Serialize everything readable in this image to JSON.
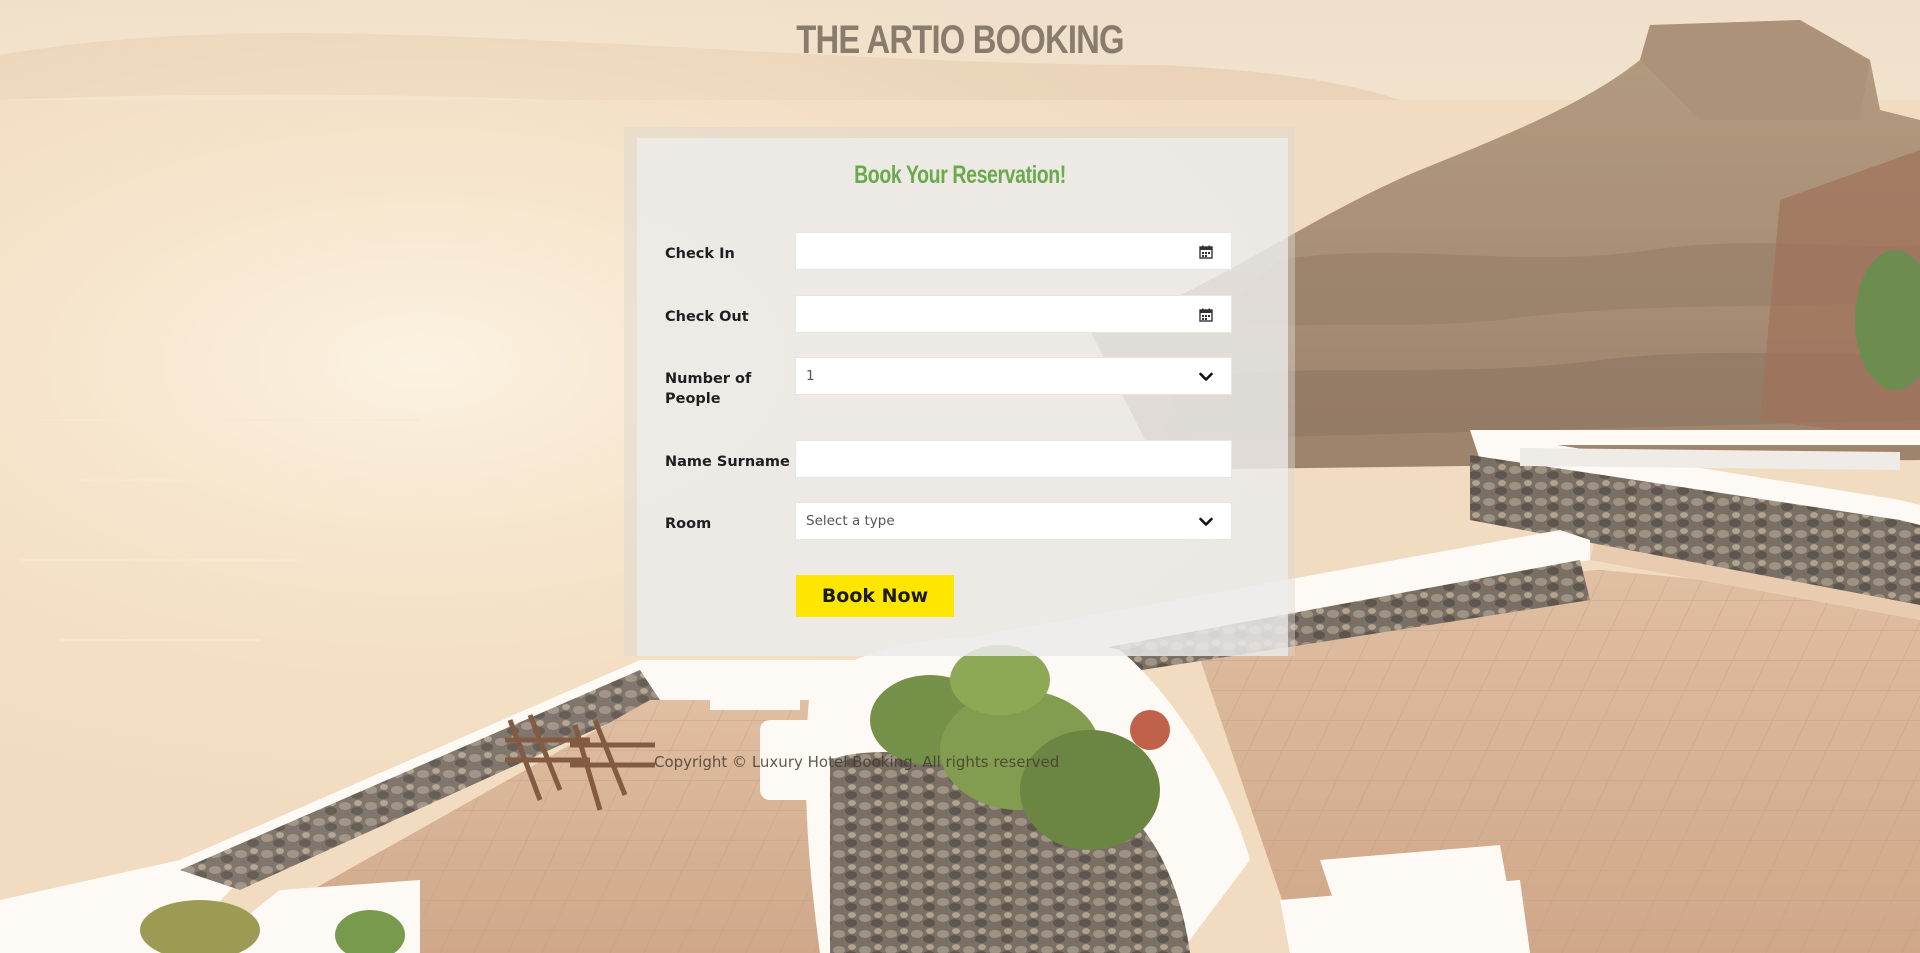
{
  "header": {
    "site_title": "THE ARTIO BOOKING"
  },
  "form": {
    "heading": "Book Your Reservation!",
    "check_in": {
      "label": "Check In",
      "value": "",
      "icon": "calendar-icon"
    },
    "check_out": {
      "label": "Check Out",
      "value": "",
      "icon": "calendar-icon"
    },
    "people": {
      "label": "Number of People",
      "selected": "1",
      "icon": "chevron-down-icon"
    },
    "name": {
      "label": "Name Surname",
      "value": ""
    },
    "room": {
      "label": "Room",
      "selected": "Select a type",
      "icon": "chevron-down-icon"
    },
    "submit_label": "Book Now"
  },
  "footer": {
    "copyright": "Copyright © Luxury Hotel Booking. All rights reserved"
  },
  "colors": {
    "title": "#8a7c6c",
    "heading_green": "#6ba94d",
    "button_yellow": "#ffe600"
  }
}
